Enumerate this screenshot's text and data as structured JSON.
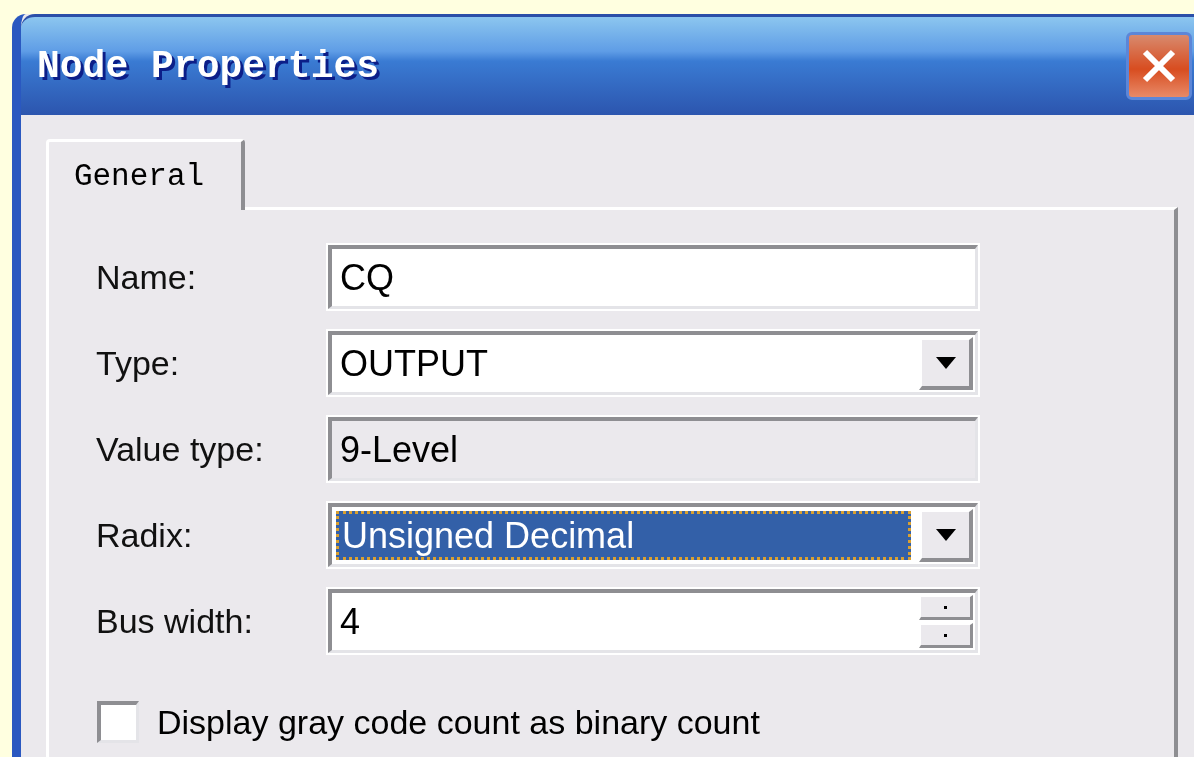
{
  "window": {
    "title": "Node Properties"
  },
  "tabs": [
    {
      "label": "General",
      "selected": true
    }
  ],
  "fields": [
    {
      "kind": "text",
      "label": "Name:",
      "value": "CQ"
    },
    {
      "kind": "dropdown",
      "label": "Type:",
      "value": "OUTPUT",
      "focused": false
    },
    {
      "kind": "readonly",
      "label": "Value type:",
      "value": "9-Level"
    },
    {
      "kind": "dropdown",
      "label": "Radix:",
      "value": "Unsigned Decimal",
      "focused": true
    },
    {
      "kind": "spin",
      "label": "Bus width:",
      "value": "4"
    }
  ],
  "checkbox": {
    "label": "Display gray code count as binary count",
    "checked": false
  }
}
